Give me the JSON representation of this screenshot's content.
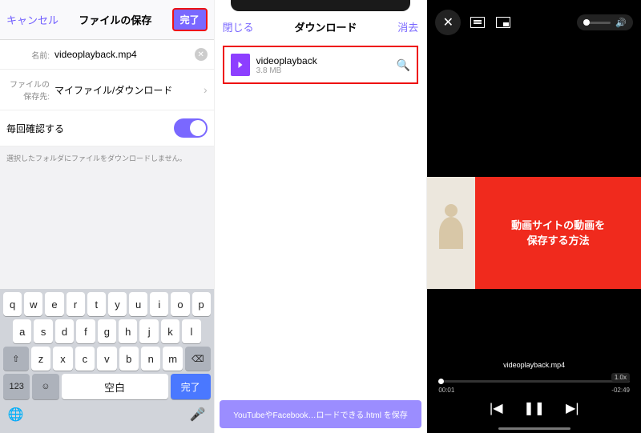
{
  "panel1": {
    "cancel": "キャンセル",
    "title": "ファイルの保存",
    "done": "完了",
    "name_label": "名前:",
    "name_value": "videoplayback.mp4",
    "dest_label": "ファイルの保存先:",
    "dest_value": "マイファイル/ダウンロード",
    "confirm_label": "毎回確認する",
    "note": "選択したフォルダにファイルをダウンロードしません。"
  },
  "keyboard": {
    "row1": [
      "q",
      "w",
      "e",
      "r",
      "t",
      "y",
      "u",
      "i",
      "o",
      "p"
    ],
    "row2": [
      "a",
      "s",
      "d",
      "f",
      "g",
      "h",
      "j",
      "k",
      "l"
    ],
    "row3": [
      "z",
      "x",
      "c",
      "v",
      "b",
      "n",
      "m"
    ],
    "shift_glyph": "⇧",
    "delete_glyph": "⌫",
    "num_label": "123",
    "emoji_glyph": "☺",
    "space_label": "空白",
    "done_label": "完了",
    "globe_glyph": "🌐",
    "mic_glyph": "🎤"
  },
  "panel2": {
    "close": "閉じる",
    "title": "ダウンロード",
    "clear": "消去",
    "file_name": "videoplayback",
    "file_size": "3.8 MB",
    "search_glyph": "🔍",
    "banner": "YouTubeやFacebook…ロードできる.html を保存"
  },
  "panel3": {
    "close_glyph": "✕",
    "thumb_line1": "動画サイトの動画を",
    "thumb_line2": "保存する方法",
    "filename": "videoplayback.mp4",
    "time_current": "00:01",
    "time_remain": "-02:49",
    "speed": "1.0x",
    "prev_glyph": "▶|",
    "pause_glyph": "❚❚",
    "next_glyph": "▶|",
    "speaker_glyph": "🔊"
  }
}
